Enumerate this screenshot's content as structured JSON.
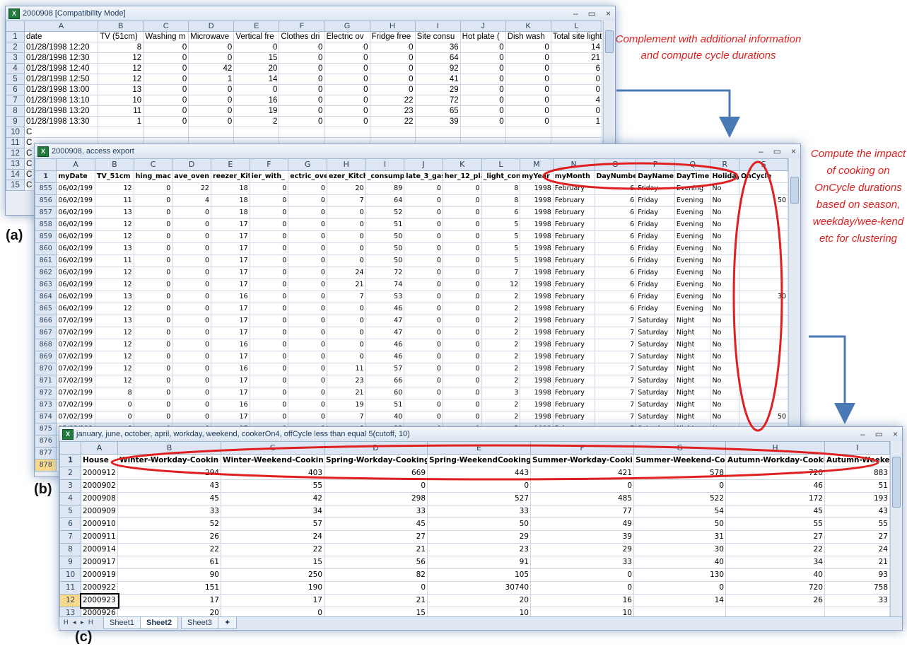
{
  "window_a": {
    "title": "2000908  [Compatibility Mode]",
    "columns": [
      "",
      "A",
      "B",
      "C",
      "D",
      "E",
      "F",
      "G",
      "H",
      "I",
      "J",
      "K",
      "L"
    ],
    "rows": [
      {
        "n": "1",
        "cells": [
          "date",
          "TV (51cm)",
          "Washing m",
          "Microwave",
          "Vertical fre",
          "Clothes dri",
          "Electric ov",
          "Fridge free",
          "Site consu",
          "Hot plate (",
          "Dish wash",
          "Total site light"
        ]
      },
      {
        "n": "2",
        "cells": [
          "01/28/1998 12:20",
          "8",
          "0",
          "0",
          "0",
          "0",
          "0",
          "0",
          "36",
          "0",
          "0",
          "14"
        ]
      },
      {
        "n": "3",
        "cells": [
          "01/28/1998 12:30",
          "12",
          "0",
          "0",
          "15",
          "0",
          "0",
          "0",
          "64",
          "0",
          "0",
          "21"
        ]
      },
      {
        "n": "4",
        "cells": [
          "01/28/1998 12:40",
          "12",
          "0",
          "42",
          "20",
          "0",
          "0",
          "0",
          "92",
          "0",
          "0",
          "6"
        ]
      },
      {
        "n": "5",
        "cells": [
          "01/28/1998 12:50",
          "12",
          "0",
          "1",
          "14",
          "0",
          "0",
          "0",
          "41",
          "0",
          "0",
          "0"
        ]
      },
      {
        "n": "6",
        "cells": [
          "01/28/1998 13:00",
          "13",
          "0",
          "0",
          "0",
          "0",
          "0",
          "0",
          "29",
          "0",
          "0",
          "0"
        ]
      },
      {
        "n": "7",
        "cells": [
          "01/28/1998 13:10",
          "10",
          "0",
          "0",
          "16",
          "0",
          "0",
          "22",
          "72",
          "0",
          "0",
          "4"
        ]
      },
      {
        "n": "8",
        "cells": [
          "01/28/1998 13:20",
          "11",
          "0",
          "0",
          "19",
          "0",
          "0",
          "23",
          "65",
          "0",
          "0",
          "0"
        ]
      },
      {
        "n": "9",
        "cells": [
          "01/28/1998 13:30",
          "1",
          "0",
          "0",
          "2",
          "0",
          "0",
          "22",
          "39",
          "0",
          "0",
          "1"
        ]
      },
      {
        "n": "10",
        "cells": [
          "C",
          "",
          "",
          "",
          "",
          "",
          "",
          "",
          "",
          "",
          "",
          ""
        ]
      },
      {
        "n": "11",
        "cells": [
          "C",
          "",
          "",
          "",
          "",
          "",
          "",
          "",
          "",
          "",
          "",
          ""
        ]
      },
      {
        "n": "12",
        "cells": [
          "C",
          "",
          "",
          "",
          "",
          "",
          "",
          "",
          "",
          "",
          "",
          ""
        ]
      },
      {
        "n": "13",
        "cells": [
          "C",
          "",
          "",
          "",
          "",
          "",
          "",
          "",
          "",
          "",
          "",
          ""
        ]
      },
      {
        "n": "14",
        "cells": [
          "C",
          "",
          "",
          "",
          "",
          "",
          "",
          "",
          "",
          "",
          "",
          ""
        ]
      },
      {
        "n": "15",
        "cells": [
          "C",
          "",
          "",
          "",
          "",
          "",
          "",
          "",
          "",
          "",
          "",
          ""
        ]
      }
    ]
  },
  "window_b": {
    "title": "2000908, access export",
    "columns": [
      "",
      "A",
      "B",
      "C",
      "D",
      "E",
      "F",
      "G",
      "H",
      "I",
      "J",
      "K",
      "L",
      "M",
      "N",
      "O",
      "P",
      "Q",
      "R",
      "S"
    ],
    "header": [
      "myDate",
      "TV_51cm",
      "hing_mac",
      "ave_oven",
      "reezer_Kit",
      "ier_with_",
      "ectric_ove",
      "ezer_Kitche",
      "_consump",
      "late_3_gas",
      "her_12_plac",
      "_light_con",
      "myYear",
      "myMonth",
      "DayNumber",
      "DayName",
      "DayTime",
      "Holiday",
      "OnCycle"
    ],
    "rows": [
      {
        "n": "855",
        "cells": [
          "06/02/199",
          "12",
          "0",
          "22",
          "18",
          "0",
          "0",
          "20",
          "89",
          "0",
          "0",
          "8",
          "1998",
          "February",
          "6",
          "Friday",
          "Evening",
          "No",
          ""
        ]
      },
      {
        "n": "856",
        "cells": [
          "06/02/199",
          "11",
          "0",
          "4",
          "18",
          "0",
          "0",
          "7",
          "64",
          "0",
          "0",
          "8",
          "1998",
          "February",
          "6",
          "Friday",
          "Evening",
          "No",
          "50"
        ]
      },
      {
        "n": "857",
        "cells": [
          "06/02/199",
          "13",
          "0",
          "0",
          "18",
          "0",
          "0",
          "0",
          "52",
          "0",
          "0",
          "6",
          "1998",
          "February",
          "6",
          "Friday",
          "Evening",
          "No",
          ""
        ]
      },
      {
        "n": "858",
        "cells": [
          "06/02/199",
          "12",
          "0",
          "0",
          "17",
          "0",
          "0",
          "0",
          "51",
          "0",
          "0",
          "5",
          "1998",
          "February",
          "6",
          "Friday",
          "Evening",
          "No",
          ""
        ]
      },
      {
        "n": "859",
        "cells": [
          "06/02/199",
          "12",
          "0",
          "0",
          "17",
          "0",
          "0",
          "0",
          "50",
          "0",
          "0",
          "5",
          "1998",
          "February",
          "6",
          "Friday",
          "Evening",
          "No",
          ""
        ]
      },
      {
        "n": "860",
        "cells": [
          "06/02/199",
          "13",
          "0",
          "0",
          "17",
          "0",
          "0",
          "0",
          "50",
          "0",
          "0",
          "5",
          "1998",
          "February",
          "6",
          "Friday",
          "Evening",
          "No",
          ""
        ]
      },
      {
        "n": "861",
        "cells": [
          "06/02/199",
          "11",
          "0",
          "0",
          "17",
          "0",
          "0",
          "0",
          "50",
          "0",
          "0",
          "5",
          "1998",
          "February",
          "6",
          "Friday",
          "Evening",
          "No",
          ""
        ]
      },
      {
        "n": "862",
        "cells": [
          "06/02/199",
          "12",
          "0",
          "0",
          "17",
          "0",
          "0",
          "24",
          "72",
          "0",
          "0",
          "7",
          "1998",
          "February",
          "6",
          "Friday",
          "Evening",
          "No",
          ""
        ]
      },
      {
        "n": "863",
        "cells": [
          "06/02/199",
          "12",
          "0",
          "0",
          "17",
          "0",
          "0",
          "21",
          "74",
          "0",
          "0",
          "12",
          "1998",
          "February",
          "6",
          "Friday",
          "Evening",
          "No",
          ""
        ]
      },
      {
        "n": "864",
        "cells": [
          "06/02/199",
          "13",
          "0",
          "0",
          "16",
          "0",
          "0",
          "7",
          "53",
          "0",
          "0",
          "2",
          "1998",
          "February",
          "6",
          "Friday",
          "Evening",
          "No",
          "30"
        ]
      },
      {
        "n": "865",
        "cells": [
          "06/02/199",
          "12",
          "0",
          "0",
          "17",
          "0",
          "0",
          "0",
          "46",
          "0",
          "0",
          "2",
          "1998",
          "February",
          "6",
          "Friday",
          "Evening",
          "No",
          ""
        ]
      },
      {
        "n": "866",
        "cells": [
          "07/02/199",
          "13",
          "0",
          "0",
          "17",
          "0",
          "0",
          "0",
          "47",
          "0",
          "0",
          "2",
          "1998",
          "February",
          "7",
          "Saturday",
          "Night",
          "No",
          ""
        ]
      },
      {
        "n": "867",
        "cells": [
          "07/02/199",
          "12",
          "0",
          "0",
          "17",
          "0",
          "0",
          "0",
          "47",
          "0",
          "0",
          "2",
          "1998",
          "February",
          "7",
          "Saturday",
          "Night",
          "No",
          ""
        ]
      },
      {
        "n": "868",
        "cells": [
          "07/02/199",
          "12",
          "0",
          "0",
          "16",
          "0",
          "0",
          "0",
          "46",
          "0",
          "0",
          "2",
          "1998",
          "February",
          "7",
          "Saturday",
          "Night",
          "No",
          ""
        ]
      },
      {
        "n": "869",
        "cells": [
          "07/02/199",
          "12",
          "0",
          "0",
          "17",
          "0",
          "0",
          "0",
          "46",
          "0",
          "0",
          "2",
          "1998",
          "February",
          "7",
          "Saturday",
          "Night",
          "No",
          ""
        ]
      },
      {
        "n": "870",
        "cells": [
          "07/02/199",
          "12",
          "0",
          "0",
          "16",
          "0",
          "0",
          "11",
          "57",
          "0",
          "0",
          "2",
          "1998",
          "February",
          "7",
          "Saturday",
          "Night",
          "No",
          ""
        ]
      },
      {
        "n": "871",
        "cells": [
          "07/02/199",
          "12",
          "0",
          "0",
          "17",
          "0",
          "0",
          "23",
          "66",
          "0",
          "0",
          "2",
          "1998",
          "February",
          "7",
          "Saturday",
          "Night",
          "No",
          ""
        ]
      },
      {
        "n": "872",
        "cells": [
          "07/02/199",
          "8",
          "0",
          "0",
          "17",
          "0",
          "0",
          "21",
          "60",
          "0",
          "0",
          "3",
          "1998",
          "February",
          "7",
          "Saturday",
          "Night",
          "No",
          ""
        ]
      },
      {
        "n": "873",
        "cells": [
          "07/02/199",
          "0",
          "0",
          "0",
          "16",
          "0",
          "0",
          "19",
          "51",
          "0",
          "0",
          "2",
          "1998",
          "February",
          "7",
          "Saturday",
          "Night",
          "No",
          ""
        ]
      },
      {
        "n": "874",
        "cells": [
          "07/02/199",
          "0",
          "0",
          "0",
          "17",
          "0",
          "0",
          "7",
          "40",
          "0",
          "0",
          "2",
          "1998",
          "February",
          "7",
          "Saturday",
          "Night",
          "No",
          "50"
        ]
      },
      {
        "n": "875",
        "cells": [
          "07/02/199",
          "0",
          "0",
          "0",
          "17",
          "0",
          "0",
          "0",
          "35",
          "0",
          "0",
          "2",
          "1998",
          "February",
          "7",
          "Saturday",
          "Night",
          "No",
          ""
        ]
      },
      {
        "n": "876",
        "cells": [
          "C",
          "",
          "",
          "",
          "",
          "",
          "",
          "",
          "",
          "",
          "",
          "",
          "",
          "",
          "",
          "",
          "",
          "",
          ""
        ]
      },
      {
        "n": "877",
        "cells": [
          "C",
          "",
          "",
          "",
          "",
          "",
          "",
          "",
          "",
          "",
          "",
          "",
          "",
          "",
          "",
          "",
          "",
          "",
          ""
        ]
      },
      {
        "n": "878",
        "cells": [
          "C",
          "",
          "",
          "",
          "",
          "",
          "",
          "",
          "",
          "",
          "",
          "",
          "",
          "",
          "",
          "",
          "",
          "",
          ""
        ]
      }
    ]
  },
  "window_c": {
    "title": "january, june, october, april, workday, weekend, cookerOn4, offCycle less than equal 5(cutoff, 10)",
    "columns": [
      "",
      "A",
      "B",
      "C",
      "D",
      "E",
      "F",
      "G",
      "H",
      "I"
    ],
    "header": [
      "House",
      "Winter-Workday-Cookin",
      "Winter-Weekend-Cookin",
      "Spring-Workday-Cooking",
      "Spring-WeekendCooking",
      "Summer-Workday-Cooki",
      "Summer-Weekend-Cook",
      "Autumn-Workday-Cooki",
      "Autumn-Weekend-C"
    ],
    "rows": [
      {
        "n": "2",
        "cells": [
          "2000912",
          "294",
          "403",
          "669",
          "443",
          "421",
          "578",
          "720",
          "883"
        ]
      },
      {
        "n": "3",
        "cells": [
          "2000902",
          "43",
          "55",
          "0",
          "0",
          "0",
          "0",
          "46",
          "51"
        ]
      },
      {
        "n": "4",
        "cells": [
          "2000908",
          "45",
          "42",
          "298",
          "527",
          "485",
          "522",
          "172",
          "193"
        ]
      },
      {
        "n": "5",
        "cells": [
          "2000909",
          "33",
          "34",
          "33",
          "33",
          "77",
          "54",
          "45",
          "43"
        ]
      },
      {
        "n": "6",
        "cells": [
          "2000910",
          "52",
          "57",
          "45",
          "50",
          "49",
          "50",
          "55",
          "55"
        ]
      },
      {
        "n": "7",
        "cells": [
          "2000911",
          "26",
          "24",
          "27",
          "29",
          "39",
          "31",
          "27",
          "27"
        ]
      },
      {
        "n": "8",
        "cells": [
          "2000914",
          "22",
          "22",
          "21",
          "23",
          "29",
          "30",
          "22",
          "24"
        ]
      },
      {
        "n": "9",
        "cells": [
          "2000917",
          "61",
          "15",
          "56",
          "91",
          "33",
          "40",
          "34",
          "21"
        ]
      },
      {
        "n": "10",
        "cells": [
          "2000919",
          "90",
          "250",
          "82",
          "105",
          "0",
          "130",
          "40",
          "93"
        ]
      },
      {
        "n": "11",
        "cells": [
          "2000922",
          "151",
          "190",
          "0",
          "30740",
          "0",
          "0",
          "720",
          "758"
        ]
      },
      {
        "n": "12",
        "cells": [
          "2000923",
          "17",
          "17",
          "21",
          "20",
          "16",
          "14",
          "26",
          "33"
        ]
      },
      {
        "n": "13",
        "cells": [
          "2000926",
          "20",
          "0",
          "15",
          "10",
          "10",
          "",
          "",
          ""
        ]
      }
    ],
    "sheet_tabs": [
      "Sheet1",
      "Sheet2",
      "Sheet3"
    ],
    "active_sheet": "Sheet2",
    "nav_glyphs": "H ◂ ▸ H"
  },
  "annotations": {
    "note1": "Complement with additional information and compute cycle durations",
    "note2": "Compute the impact of cooking on OnCycle durations based on season, weekday/wee-kend etc for clustering",
    "label_a": "(a)",
    "label_b": "(b)",
    "label_c": "(c)"
  },
  "colors": {
    "highlight": "#e02020",
    "arrow": "#4a7ab5",
    "glow": "#6e9ed0"
  }
}
